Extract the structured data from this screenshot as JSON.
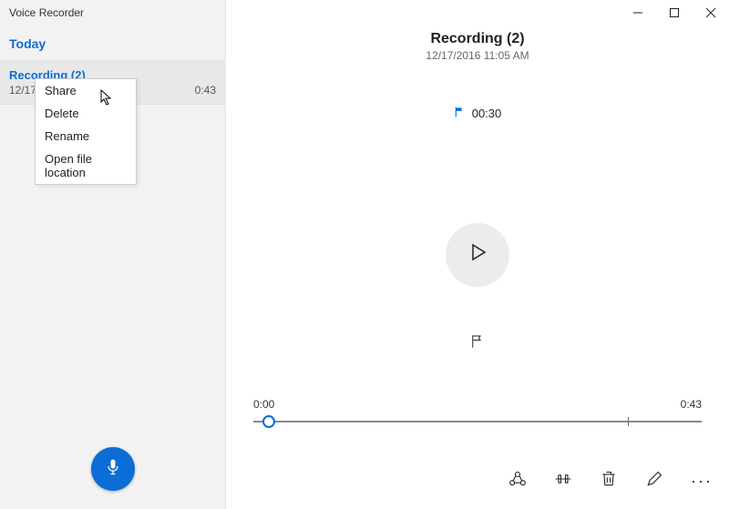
{
  "app": {
    "title": "Voice Recorder"
  },
  "win": {
    "min": "Minimize",
    "max": "Maximize",
    "close": "Close"
  },
  "sidebar": {
    "section": "Today",
    "items": [
      {
        "name": "Recording (2)",
        "date": "12/17/",
        "duration": "0:43"
      }
    ]
  },
  "context_menu": {
    "share": "Share",
    "delete": "Delete",
    "rename": "Rename",
    "open_location": "Open file location"
  },
  "main": {
    "title": "Recording (2)",
    "datetime": "12/17/2016 11:05 AM",
    "marker_time": "00:30",
    "timeline": {
      "start": "0:00",
      "end": "0:43"
    }
  },
  "toolbar": {
    "share": "Share",
    "trim": "Trim",
    "delete": "Delete",
    "rename": "Rename",
    "more": "More"
  },
  "record_button": "Record"
}
